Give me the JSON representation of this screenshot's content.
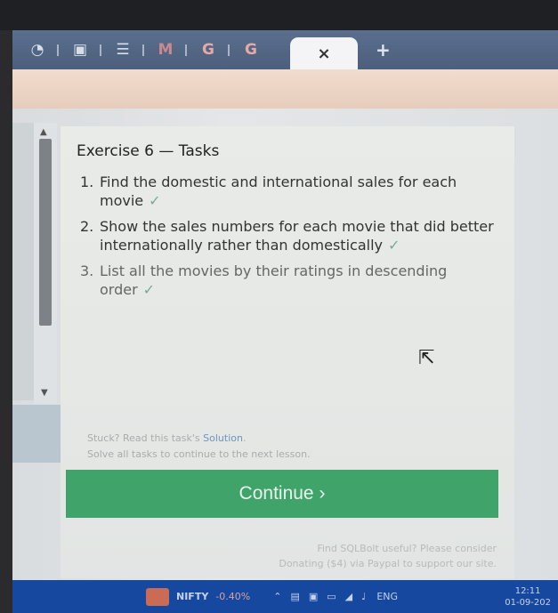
{
  "browser": {
    "tabs": [
      {
        "icon": "github-icon",
        "glyph": "◔"
      },
      {
        "icon": "clipboard-icon",
        "glyph": "▣"
      },
      {
        "icon": "checklist-icon",
        "glyph": "☰"
      },
      {
        "icon": "gmail-icon",
        "glyph": "M"
      },
      {
        "icon": "google-icon",
        "glyph": "G"
      },
      {
        "icon": "google-icon",
        "glyph": "G"
      }
    ],
    "active_tab_close": "×",
    "new_tab": "+"
  },
  "exercise": {
    "title": "Exercise 6 — Tasks",
    "tasks": [
      {
        "num": "1.",
        "text": "Find the domestic and international sales for each movie",
        "check": "✓"
      },
      {
        "num": "2.",
        "text": "Show the sales numbers for each movie that did better internationally rather than domestically",
        "check": "✓"
      },
      {
        "num": "3.",
        "text": "List all the movies by their ratings in descending order",
        "check": "✓"
      }
    ],
    "stuck_text": "Stuck? Read this task's",
    "solution_link": "Solution",
    "solve_all": "Solve all tasks to continue to the next lesson.",
    "continue_label": "Continue ›"
  },
  "footer": {
    "line1": "Find SQLBolt useful? Please consider",
    "line2": "Donating ($4) via Paypal to support our site."
  },
  "taskbar": {
    "ticker": "NIFTY",
    "ticker_change": "-0.40%",
    "language": "ENG",
    "time": "12:11",
    "date": "01-09-202"
  },
  "colors": {
    "continue_green": "#3fa36a",
    "tabbar": "#5a6f8e",
    "taskbar": "#15489e"
  }
}
